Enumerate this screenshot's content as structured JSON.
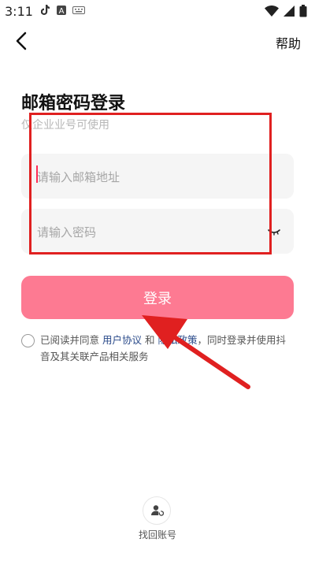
{
  "status_bar": {
    "time": "3:11"
  },
  "header": {
    "help_label": "帮助"
  },
  "form": {
    "title": "邮箱密码登录",
    "subtitle": "仅企业业号可使用",
    "email_placeholder": "请输入邮箱地址",
    "email_value": "",
    "password_placeholder": "请输入密码",
    "password_value": "",
    "login_label": "登录"
  },
  "agreement": {
    "prefix": "已阅读并同意 ",
    "user_agreement": "用户协议",
    "and": " 和 ",
    "privacy_policy": "隐私政策",
    "suffix": "，同时登录并使用抖音及其关联产品相关服务"
  },
  "footer": {
    "recover_label": "找回账号"
  },
  "colors": {
    "login_button": "#fd7a92",
    "annotation": "#e02020",
    "link": "#2a4a8a",
    "caret": "#ff2c55"
  }
}
